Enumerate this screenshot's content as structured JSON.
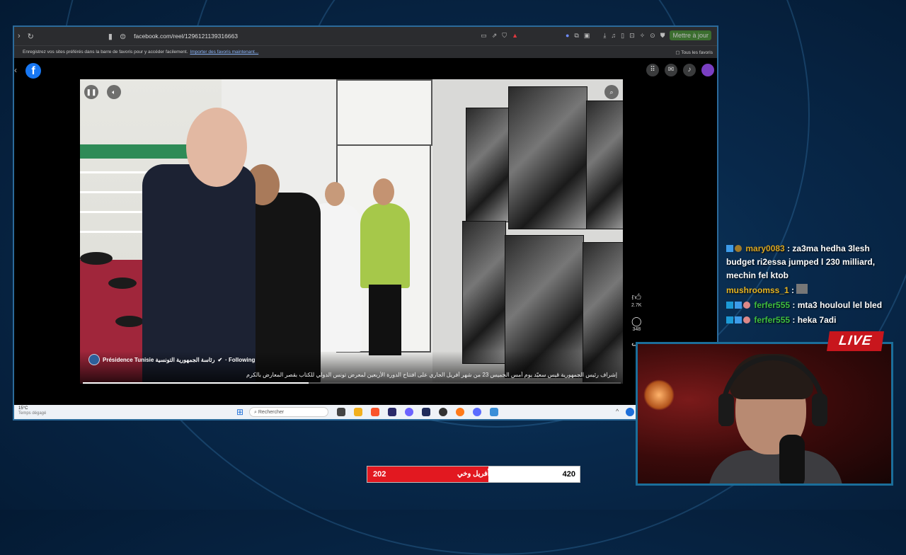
{
  "browser": {
    "url": "facebook.com/reel/1296121139316663",
    "update_button": "Mettre à jour",
    "bookmarks_hint": "Enregistrez vos sites préférés dans la barre de favoris pour y accéder facilement.",
    "bookmarks_link": "Importer des favoris maintenant...",
    "all_favorites": "Tous les favoris"
  },
  "reel": {
    "page_name": "Présidence Tunisie رئاسة الجمهورية التونسية",
    "following": "· Following",
    "description": "إشراف رئيس الجمهورية قيس سعيّد يوم أمس الخميس 23 من شهر أفريل الجاري على افتتاح الدورة الأربعين لمعرض تونس الدولي للكتاب بقصر المعارض بالكرم",
    "progress": 0.42,
    "likes": "2.7K",
    "comments": "348"
  },
  "taskbar": {
    "temperature": "15°C",
    "weather": "Temps dégagé",
    "search_placeholder": "Rechercher"
  },
  "chat": [
    {
      "user": "mary0083",
      "text": "za3ma hedha 3lesh budget ri2essa jumped l 230 milliard, mechin fel ktob"
    },
    {
      "user": "mushroomss_1",
      "text": ""
    },
    {
      "user": "ferfer555",
      "text": "mta3 houloul lel bled"
    },
    {
      "user": "ferfer555",
      "text": "heka 7adi"
    }
  ],
  "live_label": "LIVE",
  "poll": {
    "left_value": "202",
    "question": "ها أفريل وخي",
    "right_value": "420",
    "red_fraction": 0.57
  },
  "colors": {
    "facebook_blue": "#1877f2",
    "live_red": "#c8161d",
    "poll_red": "#e21820",
    "background": "#08284a"
  }
}
